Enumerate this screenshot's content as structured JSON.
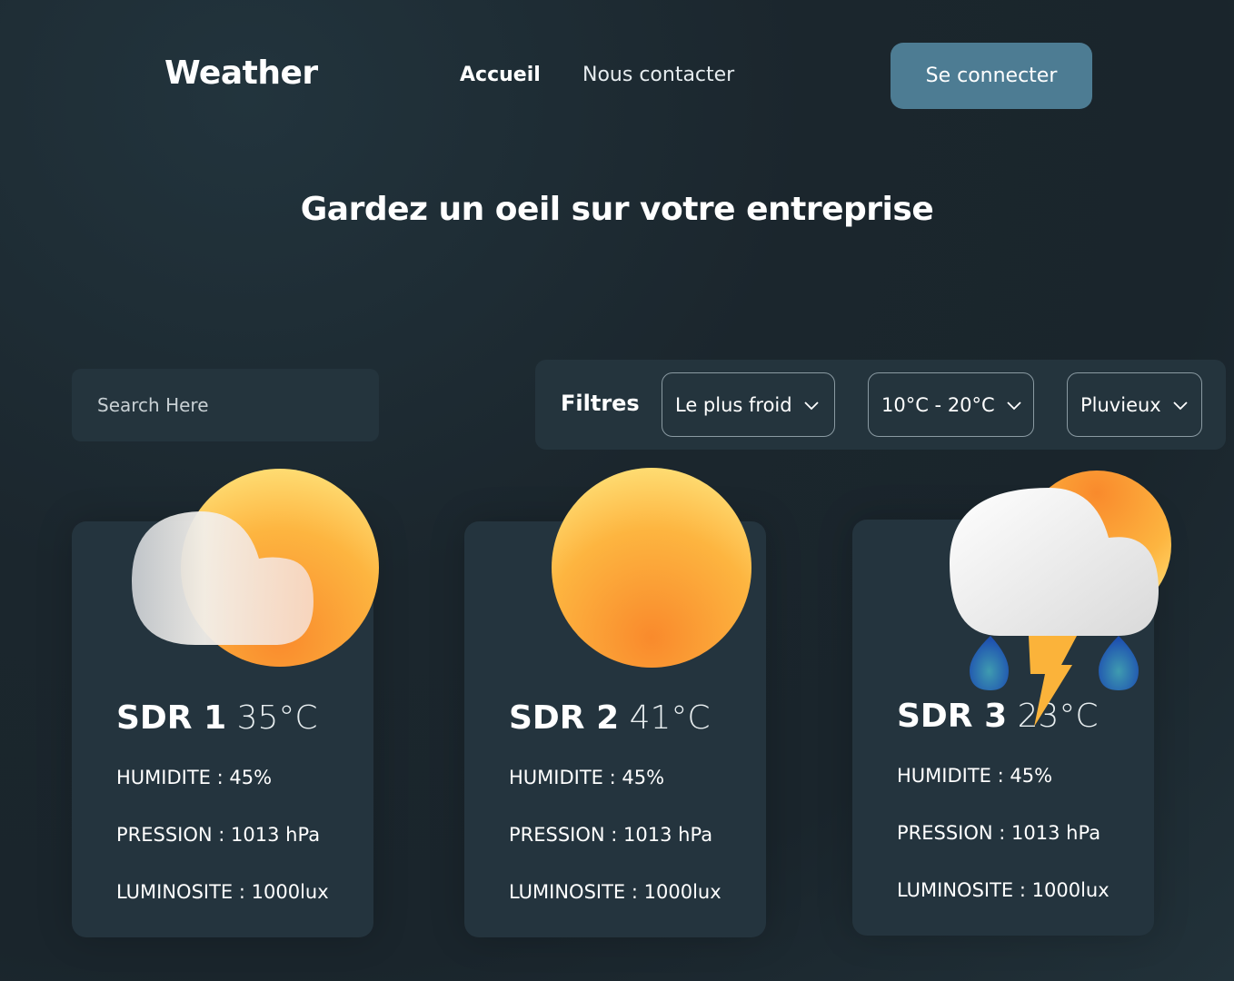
{
  "header": {
    "logo": "Weather",
    "nav": [
      "Accueil",
      "Nous contacter"
    ],
    "login_button": "Se connecter"
  },
  "hero": {
    "title": "Gardez un oeil sur votre entreprise"
  },
  "search": {
    "placeholder": "Search Here"
  },
  "filters": {
    "label": "Filtres",
    "selects": [
      "Le plus froid",
      "10°C - 20°C",
      "Pluvieux"
    ]
  },
  "cards": [
    {
      "name": "SDR 1",
      "temp": "35°C",
      "icon": "partly-cloudy-icon",
      "humidity": "HUMIDITE : 45%",
      "pressure": "PRESSION : 1013 hPa",
      "luminosity": "LUMINOSITE : 1000lux"
    },
    {
      "name": "SDR 2",
      "temp": "41°C",
      "icon": "sun-icon",
      "humidity": "HUMIDITE : 45%",
      "pressure": "PRESSION : 1013 hPa",
      "luminosity": "LUMINOSITE : 1000lux"
    },
    {
      "name": "SDR 3",
      "temp": "23°C",
      "icon": "thunderstorm-icon",
      "humidity": "HUMIDITE : 45%",
      "pressure": "PRESSION : 1013 hPa",
      "luminosity": "LUMINOSITE : 1000lux"
    }
  ],
  "colors": {
    "accent": "#4d7c93",
    "card": "#24343e",
    "background": "#1b262d"
  }
}
